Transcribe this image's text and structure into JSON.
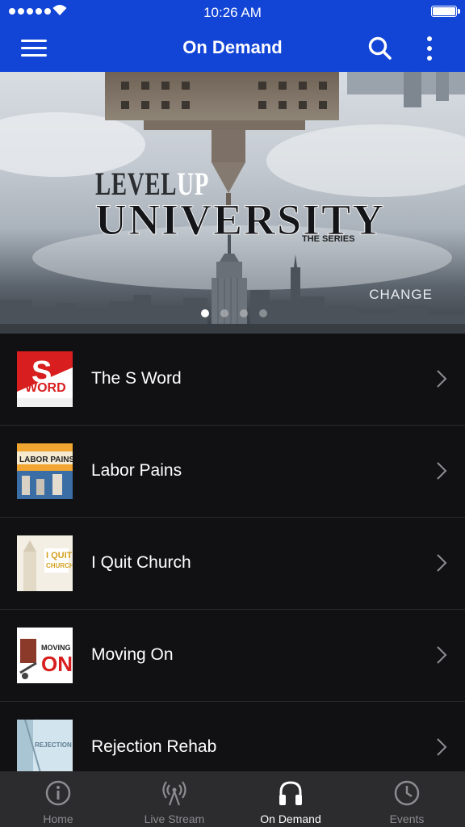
{
  "status_bar": {
    "time": "10:26 AM"
  },
  "navbar": {
    "title": "On Demand"
  },
  "hero": {
    "series_prefix_a": "LEVEL",
    "series_prefix_b": "UP",
    "series_title": "UNIVERSITY",
    "series_subtitle": "THE SERIES",
    "brand": "CHANGE",
    "slides_total": 4,
    "active_slide": 1
  },
  "list": {
    "items": [
      {
        "label": "The S Word",
        "thumb_text": "WORD",
        "colors": [
          "#d81e1e",
          "#ffffff"
        ]
      },
      {
        "label": "Labor Pains",
        "thumb_text": "LABOR PAINS",
        "colors": [
          "#f0a630",
          "#3a6ea5"
        ]
      },
      {
        "label": "I Quit Church",
        "thumb_text": "I QUIT CHURCH",
        "colors": [
          "#f4efe4",
          "#d4a01f"
        ]
      },
      {
        "label": "Moving On",
        "thumb_text": "MOVING ON!",
        "colors": [
          "#ffffff",
          "#d81e1e"
        ]
      },
      {
        "label": "Rejection Rehab",
        "thumb_text": "REJECTION",
        "colors": [
          "#d2e4ee",
          "#5f7f93"
        ]
      }
    ]
  },
  "tabbar": {
    "tabs": [
      {
        "label": "Home",
        "icon": "info-icon"
      },
      {
        "label": "Live Stream",
        "icon": "broadcast-icon"
      },
      {
        "label": "On Demand",
        "icon": "headphones-icon",
        "active": true
      },
      {
        "label": "Events",
        "icon": "clock-icon"
      }
    ]
  }
}
